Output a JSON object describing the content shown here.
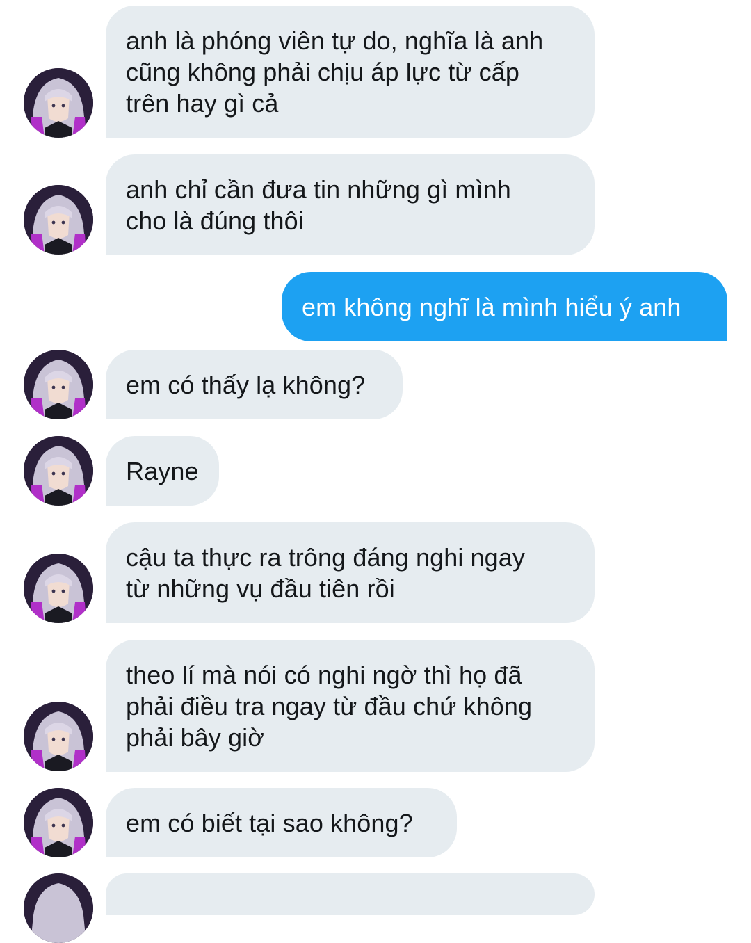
{
  "conversation": {
    "messages": [
      {
        "sender": "other",
        "text": "anh là phóng viên tự do, nghĩa là anh\ncũng không phải chịu áp lực từ cấp\ntrên hay gì cả"
      },
      {
        "sender": "other",
        "text": "anh chỉ cần đưa tin những gì mình\ncho là đúng thôi"
      },
      {
        "sender": "me",
        "text": "em không nghĩ là mình hiểu ý anh"
      },
      {
        "sender": "other",
        "text": "em có thấy lạ không?"
      },
      {
        "sender": "other",
        "text": "Rayne"
      },
      {
        "sender": "other",
        "text": "cậu ta thực ra trông đáng nghi ngay\ntừ những vụ đầu tiên rồi"
      },
      {
        "sender": "other",
        "text": "theo lí mà nói có nghi ngờ thì họ đã\nphải điều tra ngay từ đầu chứ không\nphải bây giờ"
      },
      {
        "sender": "other",
        "text": "em có biết tại sao không?"
      }
    ]
  },
  "colors": {
    "incoming_bubble": "#e6ecf0",
    "outgoing_bubble": "#1da1f2",
    "incoming_text": "#14171a",
    "outgoing_text": "#ffffff"
  },
  "icons": {
    "avatar": "anime-character-avatar"
  }
}
